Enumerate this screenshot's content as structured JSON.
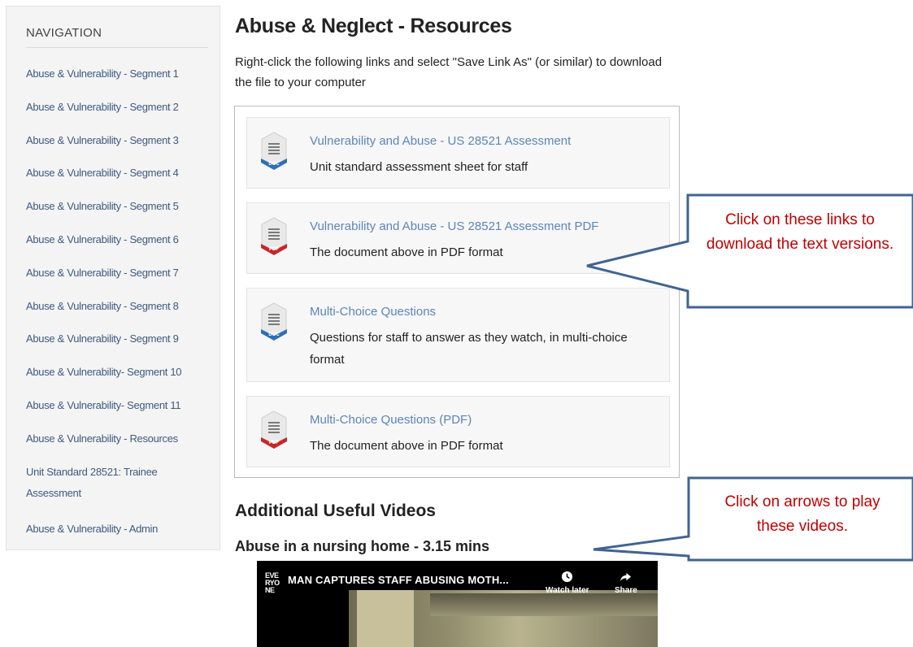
{
  "sidebar": {
    "heading": "NAVIGATION",
    "items": [
      {
        "label": "Abuse & Vulnerability - Segment 1"
      },
      {
        "label": "Abuse & Vulnerability - Segment 2"
      },
      {
        "label": "Abuse & Vulnerability - Segment 3"
      },
      {
        "label": "Abuse & Vulnerability - Segment 4"
      },
      {
        "label": "Abuse & Vulnerability - Segment 5"
      },
      {
        "label": "Abuse & Vulnerability - Segment 6"
      },
      {
        "label": "Abuse & Vulnerability - Segment 7"
      },
      {
        "label": "Abuse & Vulnerability - Segment 8"
      },
      {
        "label": "Abuse & Vulnerability - Segment 9"
      },
      {
        "label": "Abuse & Vulnerability- Segment 10"
      },
      {
        "label": "Abuse & Vulnerability- Segment 11"
      },
      {
        "label": "Abuse & Vulnerability - Resources"
      },
      {
        "label": "Unit Standard 28521: Trainee Assessment"
      },
      {
        "label": "Abuse & Vulnerability - Admin"
      }
    ]
  },
  "main": {
    "title": "Abuse & Neglect - Resources",
    "intro": "Right-click the following links and select \"Save Link As\" (or similar) to download the file to your computer",
    "files": [
      {
        "title": "Vulnerability and Abuse - US 28521 Assessment",
        "description": "Unit standard assessment sheet for staff",
        "icon": "doc-file-icon",
        "badge": "DOC"
      },
      {
        "title": "Vulnerability and Abuse - US 28521 Assessment PDF",
        "description": "The document above in PDF format",
        "icon": "pdf-file-icon",
        "badge": "PDF"
      },
      {
        "title": "Multi-Choice Questions",
        "description": "Questions for staff to answer as they watch, in multi-choice format",
        "icon": "doc-file-icon",
        "badge": "DOC"
      },
      {
        "title": "Multi-Choice Questions (PDF)",
        "description": "The document above in PDF format",
        "icon": "pdf-file-icon",
        "badge": "PDF"
      }
    ],
    "section_title": "Additional Useful Videos",
    "video_title": "Abuse in a nursing home - 3.15 mins",
    "video": {
      "channel_logo": "EVE RYO NE",
      "title": "MAN CAPTURES STAFF ABUSING MOTH...",
      "watch_later": "Watch later",
      "share": "Share"
    }
  },
  "callouts": {
    "download": "Click on these links to download the text versions.",
    "videos": "Click on arrows to play these videos."
  },
  "colors": {
    "link": "#5b86b8",
    "nav_link": "#3d5a80",
    "callout_border": "#41648f",
    "callout_text": "#c00000",
    "doc_badge": "#2f6fb5",
    "pdf_badge": "#c62828"
  }
}
